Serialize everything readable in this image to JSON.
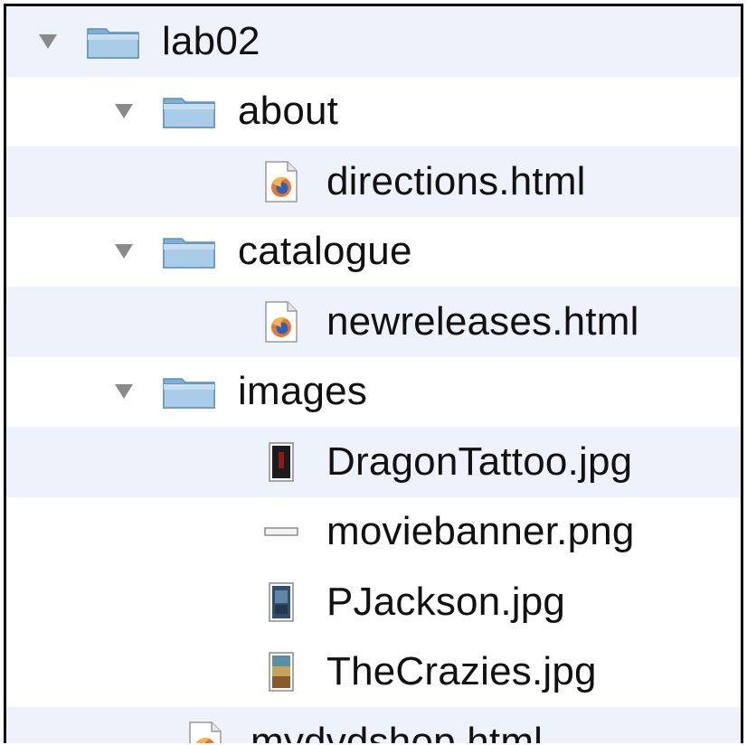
{
  "tree": {
    "items": [
      {
        "label": "lab02",
        "kind": "folder",
        "level": 0
      },
      {
        "label": "about",
        "kind": "folder",
        "level": 1
      },
      {
        "label": "directions.html",
        "kind": "html",
        "level": 2
      },
      {
        "label": "catalogue",
        "kind": "folder",
        "level": 1
      },
      {
        "label": "newreleases.html",
        "kind": "html",
        "level": 2
      },
      {
        "label": "images",
        "kind": "folder",
        "level": 1
      },
      {
        "label": "DragonTattoo.jpg",
        "kind": "jpg-dark",
        "level": 2
      },
      {
        "label": "moviebanner.png",
        "kind": "png-banner",
        "level": 2
      },
      {
        "label": "PJackson.jpg",
        "kind": "jpg-blue",
        "level": 2
      },
      {
        "label": "TheCrazies.jpg",
        "kind": "jpg-warm",
        "level": 2
      },
      {
        "label": "mydvdshop.html",
        "kind": "html",
        "level": 1
      }
    ]
  },
  "colors": {
    "row_alt": "#edf2fb",
    "folder": "#9fc6e2",
    "disclosure": "#8a8a8a"
  }
}
